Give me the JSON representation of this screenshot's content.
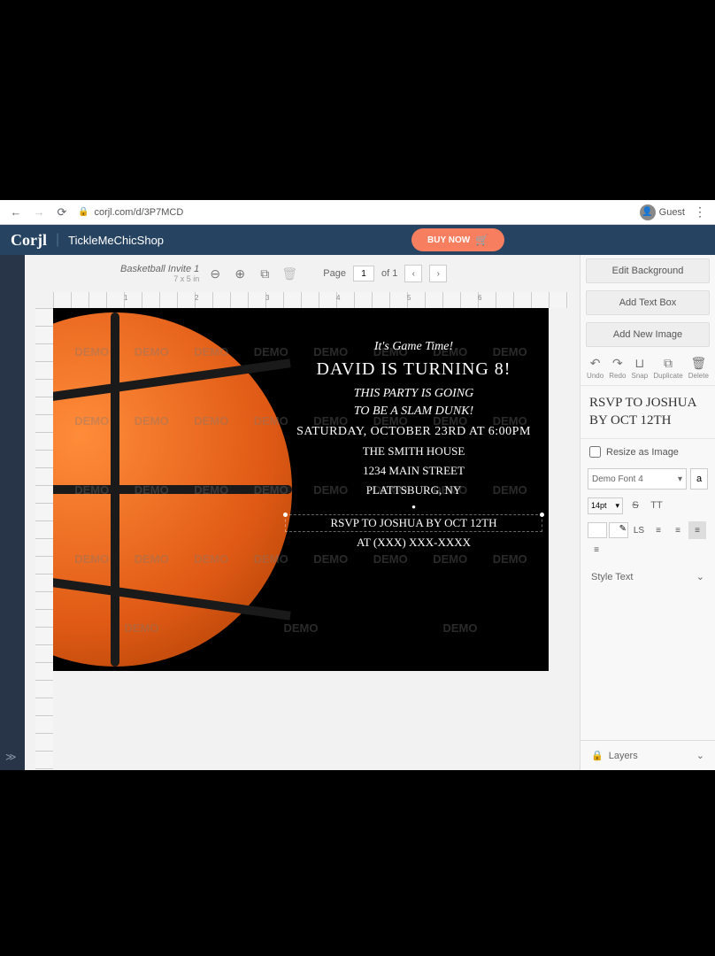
{
  "browser": {
    "url": "corjl.com/d/3P7MCD",
    "user_label": "Guest"
  },
  "header": {
    "logo": "Corjl",
    "shop": "TickleMeChicShop",
    "buy_now": "BUY NOW"
  },
  "document": {
    "title": "Basketball Invite 1",
    "dimensions": "7 x 5 in"
  },
  "pager": {
    "label_page": "Page",
    "current": "1",
    "label_of": "of 1"
  },
  "invite": {
    "line1": "It's Game Time!",
    "line2": "DAVID IS TURNING 8!",
    "line3a": "THIS PARTY IS GOING",
    "line3b": "TO BE A SLAM DUNK!",
    "line4": "SATURDAY, OCTOBER 23RD AT 6:00PM",
    "line5": "THE SMITH HOUSE",
    "line6": "1234 MAIN STREET",
    "line7": "PLATTSBURG, NY",
    "line8": "RSVP TO JOSHUA BY OCT 12TH",
    "line9": "AT (XXX) XXX-XXXX"
  },
  "watermark": "DEMO",
  "sidepanel": {
    "edit_bg": "Edit Background",
    "add_text": "Add Text Box",
    "add_image": "Add New Image",
    "tools": {
      "undo": "Undo",
      "redo": "Redo",
      "snap": "Snap",
      "duplicate": "Duplicate",
      "delete": "Delete"
    },
    "selected_text": "RSVP TO JOSHUA BY OCT 12TH",
    "resize_label": "Resize as Image",
    "font_name": "Demo Font 4",
    "font_size": "14pt",
    "style_text": "Style Text",
    "layers": "Layers"
  },
  "ruler_marks": [
    "1",
    "2",
    "3",
    "4",
    "5",
    "6"
  ]
}
